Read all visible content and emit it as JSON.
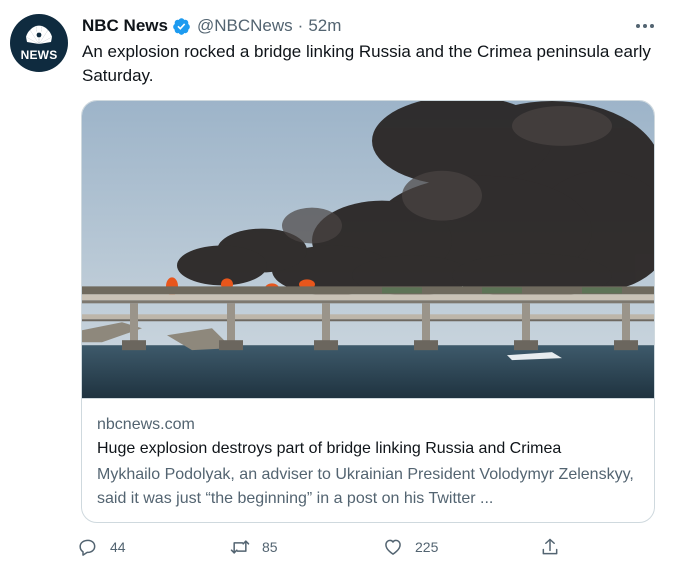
{
  "author": {
    "display_name": "NBC News",
    "handle": "@NBCNews",
    "separator": "·",
    "time": "52m",
    "avatar_text": "NEWS",
    "verified": true
  },
  "tweet": {
    "text": "An explosion rocked a bridge linking Russia and the Crimea peninsula early Saturday."
  },
  "card": {
    "domain": "nbcnews.com",
    "title": "Huge explosion destroys part of bridge linking Russia and Crimea",
    "description": "Mykhailo Podolyak, an adviser to Ukrainian President Volodymyr Zelenskyy, said it was just “the beginning” in a post on his Twitter ..."
  },
  "actions": {
    "replies": "44",
    "retweets": "85",
    "likes": "225"
  },
  "icons": {
    "more": "more-icon",
    "reply": "reply-icon",
    "retweet": "retweet-icon",
    "like": "like-icon",
    "share": "share-icon",
    "verified": "verified-badge-icon"
  },
  "colors": {
    "text": "#0f1419",
    "secondary": "#536471",
    "border": "#cfd9de",
    "verified": "#1d9bf0",
    "avatar_bg": "#0f2b3f"
  }
}
